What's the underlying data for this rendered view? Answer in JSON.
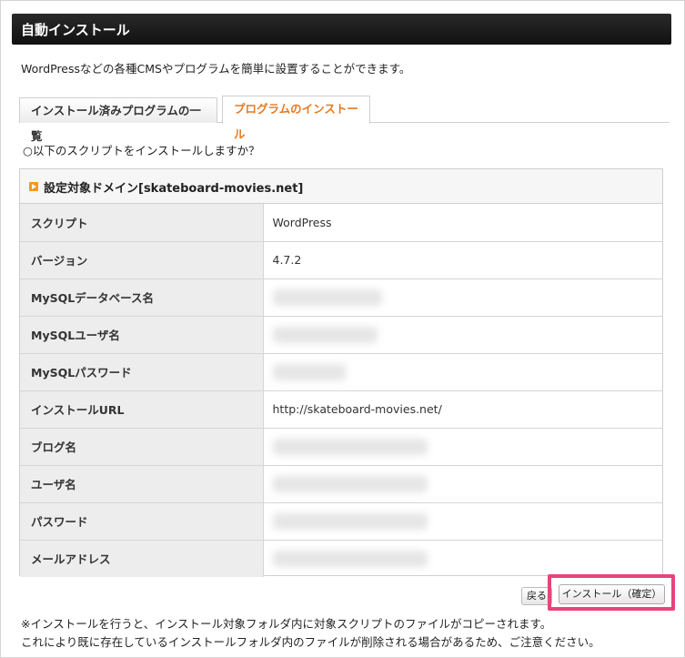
{
  "header": {
    "title": "自動インストール"
  },
  "intro": "WordPressなどの各種CMSやプログラムを簡単に設置することができます。",
  "tabs": [
    {
      "label": "インストール済みプログラムの一覧",
      "active": false
    },
    {
      "label": "プログラムのインストール",
      "active": true
    }
  ],
  "question": "○以下のスクリプトをインストールしますか？",
  "panel": {
    "heading": "設定対象ドメイン[skateboard-movies.net]",
    "rows": [
      {
        "label": "スクリプト",
        "value": "WordPress"
      },
      {
        "label": "バージョン",
        "value": "4.7.2"
      },
      {
        "label": "MySQLデータベース名",
        "value": ""
      },
      {
        "label": "MySQLユーザ名",
        "value": ""
      },
      {
        "label": "MySQLパスワード",
        "value": ""
      },
      {
        "label": "インストールURL",
        "value": "http://skateboard-movies.net/"
      },
      {
        "label": "ブログ名",
        "value": ""
      },
      {
        "label": "ユーザ名",
        "value": ""
      },
      {
        "label": "パスワード",
        "value": ""
      },
      {
        "label": "メールアドレス",
        "value": ""
      }
    ]
  },
  "buttons": {
    "back": "戻る",
    "install": "インストール（確定）"
  },
  "notes": [
    "※インストールを行うと、インストール対象フォルダ内に対象スクリプトのファイルがコピーされます。",
    "これにより既に存在しているインストールフォルダ内のファイルが削除される場合があるため、ご注意ください。"
  ],
  "colors": {
    "accent": "#e8791f",
    "highlight": "#e6447c",
    "header_bg": "#111111"
  }
}
